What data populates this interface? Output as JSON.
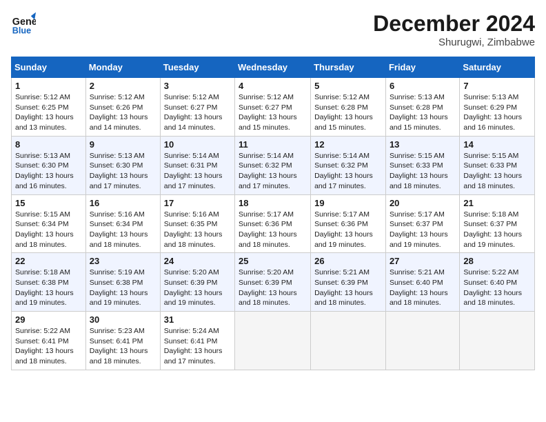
{
  "header": {
    "logo_line1": "General",
    "logo_line2": "Blue",
    "month_title": "December 2024",
    "location": "Shurugwi, Zimbabwe"
  },
  "days_of_week": [
    "Sunday",
    "Monday",
    "Tuesday",
    "Wednesday",
    "Thursday",
    "Friday",
    "Saturday"
  ],
  "weeks": [
    [
      {
        "day": "1",
        "sunrise": "5:12 AM",
        "sunset": "6:25 PM",
        "daylight": "13 hours and 13 minutes."
      },
      {
        "day": "2",
        "sunrise": "5:12 AM",
        "sunset": "6:26 PM",
        "daylight": "13 hours and 14 minutes."
      },
      {
        "day": "3",
        "sunrise": "5:12 AM",
        "sunset": "6:27 PM",
        "daylight": "13 hours and 14 minutes."
      },
      {
        "day": "4",
        "sunrise": "5:12 AM",
        "sunset": "6:27 PM",
        "daylight": "13 hours and 15 minutes."
      },
      {
        "day": "5",
        "sunrise": "5:12 AM",
        "sunset": "6:28 PM",
        "daylight": "13 hours and 15 minutes."
      },
      {
        "day": "6",
        "sunrise": "5:13 AM",
        "sunset": "6:28 PM",
        "daylight": "13 hours and 15 minutes."
      },
      {
        "day": "7",
        "sunrise": "5:13 AM",
        "sunset": "6:29 PM",
        "daylight": "13 hours and 16 minutes."
      }
    ],
    [
      {
        "day": "8",
        "sunrise": "5:13 AM",
        "sunset": "6:30 PM",
        "daylight": "13 hours and 16 minutes."
      },
      {
        "day": "9",
        "sunrise": "5:13 AM",
        "sunset": "6:30 PM",
        "daylight": "13 hours and 17 minutes."
      },
      {
        "day": "10",
        "sunrise": "5:14 AM",
        "sunset": "6:31 PM",
        "daylight": "13 hours and 17 minutes."
      },
      {
        "day": "11",
        "sunrise": "5:14 AM",
        "sunset": "6:32 PM",
        "daylight": "13 hours and 17 minutes."
      },
      {
        "day": "12",
        "sunrise": "5:14 AM",
        "sunset": "6:32 PM",
        "daylight": "13 hours and 17 minutes."
      },
      {
        "day": "13",
        "sunrise": "5:15 AM",
        "sunset": "6:33 PM",
        "daylight": "13 hours and 18 minutes."
      },
      {
        "day": "14",
        "sunrise": "5:15 AM",
        "sunset": "6:33 PM",
        "daylight": "13 hours and 18 minutes."
      }
    ],
    [
      {
        "day": "15",
        "sunrise": "5:15 AM",
        "sunset": "6:34 PM",
        "daylight": "13 hours and 18 minutes."
      },
      {
        "day": "16",
        "sunrise": "5:16 AM",
        "sunset": "6:34 PM",
        "daylight": "13 hours and 18 minutes."
      },
      {
        "day": "17",
        "sunrise": "5:16 AM",
        "sunset": "6:35 PM",
        "daylight": "13 hours and 18 minutes."
      },
      {
        "day": "18",
        "sunrise": "5:17 AM",
        "sunset": "6:36 PM",
        "daylight": "13 hours and 18 minutes."
      },
      {
        "day": "19",
        "sunrise": "5:17 AM",
        "sunset": "6:36 PM",
        "daylight": "13 hours and 19 minutes."
      },
      {
        "day": "20",
        "sunrise": "5:17 AM",
        "sunset": "6:37 PM",
        "daylight": "13 hours and 19 minutes."
      },
      {
        "day": "21",
        "sunrise": "5:18 AM",
        "sunset": "6:37 PM",
        "daylight": "13 hours and 19 minutes."
      }
    ],
    [
      {
        "day": "22",
        "sunrise": "5:18 AM",
        "sunset": "6:38 PM",
        "daylight": "13 hours and 19 minutes."
      },
      {
        "day": "23",
        "sunrise": "5:19 AM",
        "sunset": "6:38 PM",
        "daylight": "13 hours and 19 minutes."
      },
      {
        "day": "24",
        "sunrise": "5:20 AM",
        "sunset": "6:39 PM",
        "daylight": "13 hours and 19 minutes."
      },
      {
        "day": "25",
        "sunrise": "5:20 AM",
        "sunset": "6:39 PM",
        "daylight": "13 hours and 18 minutes."
      },
      {
        "day": "26",
        "sunrise": "5:21 AM",
        "sunset": "6:39 PM",
        "daylight": "13 hours and 18 minutes."
      },
      {
        "day": "27",
        "sunrise": "5:21 AM",
        "sunset": "6:40 PM",
        "daylight": "13 hours and 18 minutes."
      },
      {
        "day": "28",
        "sunrise": "5:22 AM",
        "sunset": "6:40 PM",
        "daylight": "13 hours and 18 minutes."
      }
    ],
    [
      {
        "day": "29",
        "sunrise": "5:22 AM",
        "sunset": "6:41 PM",
        "daylight": "13 hours and 18 minutes."
      },
      {
        "day": "30",
        "sunrise": "5:23 AM",
        "sunset": "6:41 PM",
        "daylight": "13 hours and 18 minutes."
      },
      {
        "day": "31",
        "sunrise": "5:24 AM",
        "sunset": "6:41 PM",
        "daylight": "13 hours and 17 minutes."
      },
      null,
      null,
      null,
      null
    ]
  ],
  "labels": {
    "sunrise": "Sunrise:",
    "sunset": "Sunset:",
    "daylight": "Daylight:"
  }
}
